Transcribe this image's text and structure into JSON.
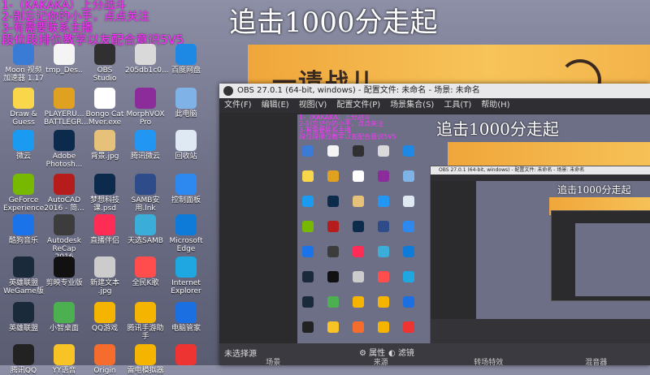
{
  "overlay": {
    "title": "追击1000分走起",
    "announce": [
      "1-（KAKAKA）上分战斗",
      "2-别忘记你的小手，点点关注",
      "3-有需要联系主播",
      "段位段排位教学以友配合意识5V5"
    ]
  },
  "desktop_icons": [
    {
      "label": "Moon 视频 加速器 1.17",
      "color": "#3a7bd5"
    },
    {
      "label": "tmp_Des..",
      "color": "#f4f4f4"
    },
    {
      "label": "OBS Studio",
      "color": "#303030"
    },
    {
      "label": "205db1c0...",
      "color": "#d9d9d9"
    },
    {
      "label": "百度网盘",
      "color": "#1e88e5"
    },
    {
      "label": "Draw & Guess",
      "color": "#f9d64a"
    },
    {
      "label": "PLAYERU... BATTLEGR...",
      "color": "#e0a020"
    },
    {
      "label": "Bongo Cat Mver.exe",
      "color": "#ffffff"
    },
    {
      "label": "MorphVOX Pro",
      "color": "#8b2c9a"
    },
    {
      "label": "此电脑",
      "color": "#7fb3e8"
    },
    {
      "label": "微云",
      "color": "#1a9af0"
    },
    {
      "label": "Adobe Photosh...",
      "color": "#0c2a4c"
    },
    {
      "label": "背景.jpg",
      "color": "#e6c17a"
    },
    {
      "label": "腾讯微云",
      "color": "#2196f3"
    },
    {
      "label": "回收站",
      "color": "#dfe9f3"
    },
    {
      "label": "GeForce Experience",
      "color": "#76b900"
    },
    {
      "label": "AutoCAD 2016 - 简...",
      "color": "#b71c1c"
    },
    {
      "label": "梦想科技 课.psd",
      "color": "#0c2a4c"
    },
    {
      "label": "SAMB安 用.lnk",
      "color": "#2e4b8a"
    },
    {
      "label": "控制面板",
      "color": "#2d89ef"
    },
    {
      "label": "酷狗音乐",
      "color": "#1a73e8"
    },
    {
      "label": "Autodesk ReCap 2016",
      "color": "#3c3c3c"
    },
    {
      "label": "直播伴侣",
      "color": "#ff2d55"
    },
    {
      "label": "天选SAMB",
      "color": "#3aaed8"
    },
    {
      "label": "Microsoft Edge",
      "color": "#0f7bd8"
    },
    {
      "label": "英雄联盟 WeGame版",
      "color": "#1b2a3a"
    },
    {
      "label": "剪映专业版",
      "color": "#111111"
    },
    {
      "label": "新建文本 .jpg",
      "color": "#cccccc"
    },
    {
      "label": "全民K歌",
      "color": "#ff4d4d"
    },
    {
      "label": "Internet Explorer",
      "color": "#1ea7e1"
    },
    {
      "label": "英雄联盟",
      "color": "#1b2a3a"
    },
    {
      "label": "小智桌面",
      "color": "#4caf50"
    },
    {
      "label": "QQ游戏",
      "color": "#f5b400"
    },
    {
      "label": "腾讯手游助手",
      "color": "#f5b400"
    },
    {
      "label": "电脑管家",
      "color": "#1b6fe0"
    },
    {
      "label": "腾讯QQ",
      "color": "#222222"
    },
    {
      "label": "YY语音",
      "color": "#f7c325"
    },
    {
      "label": "Origin",
      "color": "#f56c2d"
    },
    {
      "label": "雷电模拟器",
      "color": "#f5b400"
    },
    {
      "label": "",
      "color": "#e33"
    },
    {
      "label": "",
      "color": "#2cbe4e"
    },
    {
      "label": "",
      "color": "#f0c020"
    },
    {
      "label": "",
      "color": "#0c2a4c"
    }
  ],
  "obs": {
    "titlebar": "OBS 27.0.1 (64-bit, windows) - 配置文件: 未命名 - 场景: 未命名",
    "menu": [
      "文件(F)",
      "编辑(E)",
      "视图(V)",
      "配置文件(P)",
      "场景集合(S)",
      "工具(T)",
      "帮助(H)"
    ],
    "no_source": "未选择源",
    "properties": "属性",
    "filters": "滤镜",
    "panels": [
      "场景",
      "来源",
      "转场特效",
      "混音器"
    ],
    "inner_title": "OBS 27.0.1 (64-bit, windows) - 配置文件: 未命名 - 场景: 未命名"
  },
  "colors": {
    "accent": "#ff33ff",
    "banner": "#f0a63a",
    "obs_bg": "#2b2b2e"
  }
}
